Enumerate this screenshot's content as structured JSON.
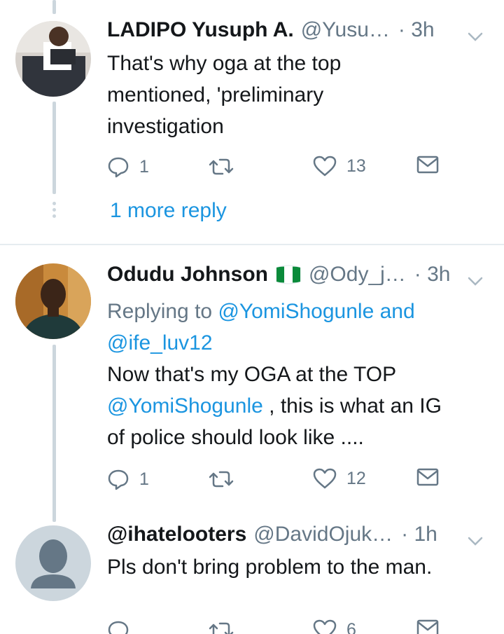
{
  "tweets": [
    {
      "name": "LADIPO Yusuph A.",
      "handle": "@Yusu…",
      "time": "· 3h",
      "body_lines": [
        "That's why oga at the top",
        "mentioned, 'preliminary",
        "investigation"
      ],
      "replies": "1",
      "retweets": "",
      "likes": "13"
    },
    {
      "name": "Odudu Johnson",
      "flag": "nigeria-flag",
      "handle": "@Ody_j…",
      "time": "· 3h",
      "replying_prefix": "Replying to ",
      "replying_mention1": "@YomiShogunle",
      "replying_and": " and",
      "replying_mention2": "@ife_luv12",
      "line1": "Now that's my OGA at the TOP",
      "line2_mention": "@YomiShogunle",
      "line2_rest": " , this is what an IG",
      "line3": "of police should look like ....",
      "replies": "1",
      "retweets": "",
      "likes": "12"
    },
    {
      "name": "@ihatelooters",
      "handle": "@DavidOjuk…",
      "time": "· 1h",
      "body": "Pls don't bring problem to the man.",
      "replies": "",
      "retweets": "",
      "likes": "6"
    }
  ],
  "more_reply": "1 more reply",
  "colors": {
    "link": "#1b95e0",
    "muted": "#657786",
    "line": "#ccd6dd",
    "text": "#14171a"
  }
}
